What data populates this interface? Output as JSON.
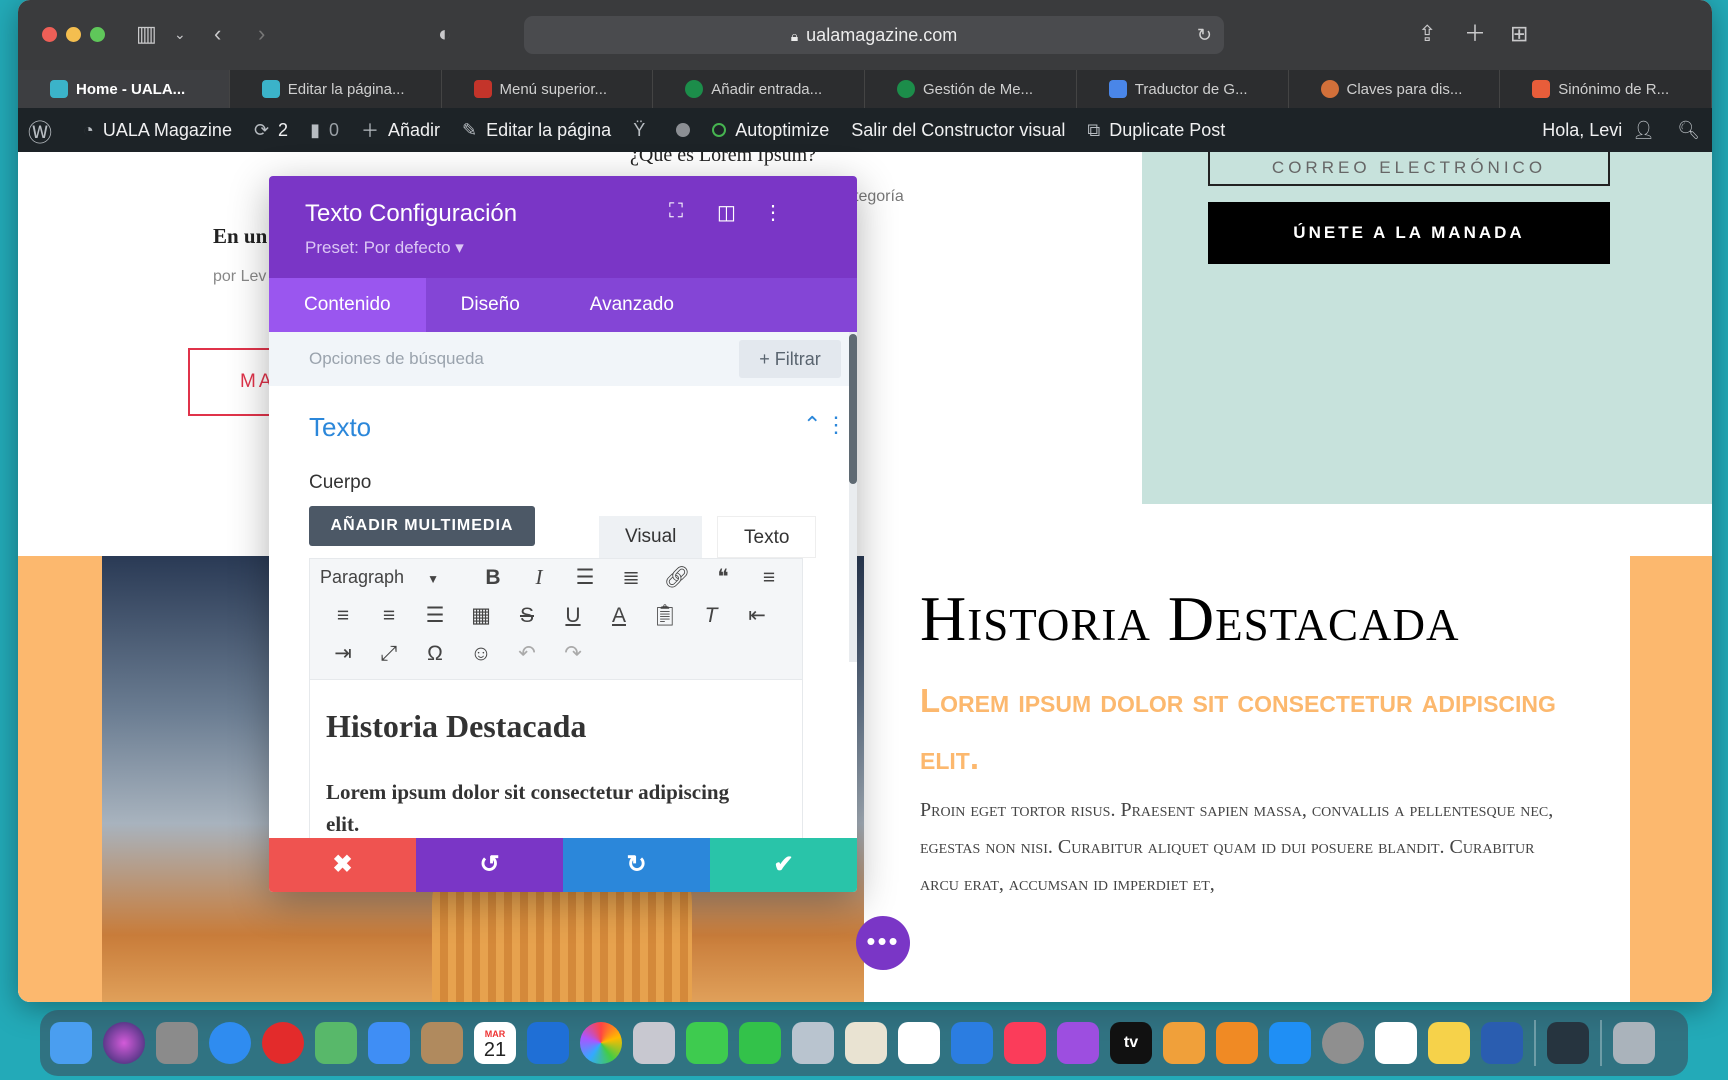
{
  "browser": {
    "url": "ualamagazine.com",
    "tabs": [
      {
        "label": "Home - UALA...",
        "color": "#3bb3c9"
      },
      {
        "label": "Editar la página...",
        "color": "#3bb3c9"
      },
      {
        "label": "Menú superior...",
        "color": "#c4342a"
      },
      {
        "label": "Añadir entrada...",
        "color": "#1c8d4a"
      },
      {
        "label": "Gestión de Me...",
        "color": "#1c8d4a"
      },
      {
        "label": "Traductor de G...",
        "color": "#4a86e8"
      },
      {
        "label": "Claves para dis...",
        "color": "#d2703a"
      },
      {
        "label": "Sinónimo de R...",
        "color": "#e85d3a"
      }
    ]
  },
  "adminbar": {
    "site": "UALA Magazine",
    "updates": "2",
    "comments": "0",
    "add": "Añadir",
    "edit_page": "Editar la página",
    "autoptimize": "Autoptimize",
    "exit_builder": "Salir del Constructor visual",
    "duplicate": "Duplicate Post",
    "greeting": "Hola, Levi"
  },
  "page": {
    "email_placeholder": "CORREO ELECTRÓNICO",
    "join_button": "ÚNETE A LA MANADA",
    "small_heading": "¿Qué es Lorem Ipsum?",
    "category_fragment": "tegoría",
    "left_heading": "En un",
    "byline": "por Lev",
    "red_button": "MA",
    "hist_title": "Historia Destacada",
    "hist_subtitle": "Lorem ipsum dolor sit consectetur adipiscing elit.",
    "hist_body": "Proin eget tortor risus. Praesent sapien massa, convallis a pellentesque nec, egestas non nisi. Curabitur aliquet quam id dui posuere blandit. Curabitur arcu erat, accumsan id imperdiet et,"
  },
  "modal": {
    "title": "Texto Configuración",
    "preset": "Preset: Por defecto ▾",
    "tabs": [
      "Contenido",
      "Diseño",
      "Avanzado"
    ],
    "search_placeholder": "Opciones de búsqueda",
    "filter": "+ Filtrar",
    "section": "Texto",
    "body_label": "Cuerpo",
    "add_media": "AÑADIR MULTIMEDIA",
    "editor_tab_visual": "Visual",
    "editor_tab_text": "Texto",
    "paragraph_select": "Paragraph",
    "editor_heading": "Historia Destacada",
    "editor_paragraph": "Lorem ipsum dolor sit consectetur adipiscing elit."
  },
  "dock": {
    "calendar_month": "MAR",
    "calendar_day": "21",
    "tv_label": "tv"
  },
  "colors": {
    "accent_purple": "#7a36c6",
    "orange": "#fcb86e",
    "mint": "#c7e2dc",
    "cancel_red": "#ef5350",
    "undo_purple": "#7a36c6",
    "redo_blue": "#2b87da",
    "save_green": "#29c4a9"
  }
}
